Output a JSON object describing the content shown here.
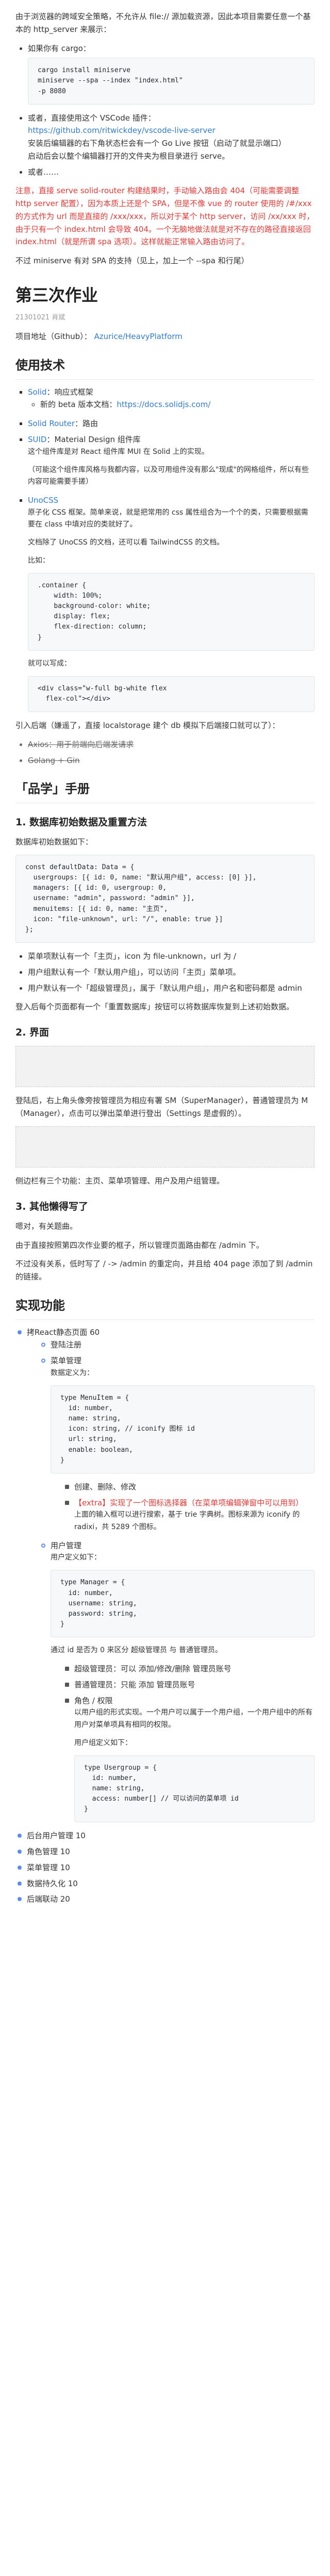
{
  "intro": {
    "p1": "由于浏览器的跨域安全策略，不允许从 file:// 源加载资源，因此本项目需要任意一个基本的 http_server 来展示：",
    "li_cargo": "如果你有 cargo：",
    "code_cargo": "cargo install miniserve\nminiserve --spa --index \"index.html\"\n-p 8080",
    "li_vscode": "或者，直接使用这个 VSCode 插件：",
    "vscode_link": "https://github.com/ritwickdey/vscode-live-server",
    "vscode_desc": "安装后编辑器的右下角状态栏会有一个 Go Live 按钮（启动了就显示端口）",
    "vscode_desc2": "启动后会以整个编辑器打开的文件夹为根目录进行 serve。",
    "li_or": "或者……",
    "warning": "注意，直接 serve solid-router 构建结果时，手动输入路由会 404（可能需要调整 http server 配置），因为本质上还是个 SPA，但是不像 vue 的 router 使用的 /#/xxx 的方式作为 url 而是直接的 /xxx/xxx，所以对于某个 http server，访问 /xx/xxx 时，由于只有一个 index.html 会导致 404。一个无脑地做法就是对不存在的路径直接返回 index.html（就是所谓 spa 选项）。这样就能正常输入路由访问了。",
    "miniserve": "不过 miniserve 有对 SPA 的支持（见上，加上一个 --spa 和行尾）"
  },
  "h1": {
    "title": "第三次作业",
    "meta": "21301021 肖斌",
    "project_label": "项目地址（Github）：",
    "project_link": "Azurice/HeavyPlatform"
  },
  "libs": {
    "title": "使用技术",
    "items": [
      {
        "name": "Solid",
        "desc": "：响应式框架"
      },
      {
        "name": "Solid Router",
        "desc": "：路由"
      },
      {
        "name": "SUID",
        "desc": "：Material Design 组件库"
      },
      {
        "name": "UnoCSS",
        "desc": ""
      }
    ],
    "solid_sub_label": "新的 beta 版本文档：",
    "solid_sub_link": "https://docs.solidjs.com/",
    "suid_desc": "这个组件库是对 React 组件库 MUI 在 Solid 上的实现。",
    "suid_desc2": "（可能这个组件库风格与我都内容，以及可用组件没有那么\"现成\"的网格组件，所以有些内容可能需要手搓）",
    "uno_desc": "原子化 CSS 框架。简单来说，就是把常用的 css 属性组合为一个个的类，只需要根据需要在 class 中填对应的类就好了。",
    "uno_desc2": "文档除了 UnoCSS 的文档，还可以看 TailwindCSS 的文档。",
    "uno_example_label": "比如：",
    "uno_code_css": ".container {\n    width: 100%;\n    background-color: white;\n    display: flex;\n    flex-direction: column;\n}",
    "uno_equal": "就可以写成：",
    "uno_code_html": "<div class=\"w-full bg-white flex\n  flex-col\"></div>"
  },
  "misc": {
    "quote": "引入后端（嫌遥了，直接 localstorage 建个 db 模拟下后端接口就可以了）：",
    "strike1": "Axios：用于前端向后端发请求",
    "strike2": "Golang + Gin"
  },
  "manual": {
    "title": "「品学」手册",
    "s1_title": "1. 数据库初始数据及重置方法",
    "s1_desc": "数据库初始数据如下：",
    "s1_code": "const defaultData: Data = {\n  usergroups: [{ id: 0, name: \"默认用户组\", access: [0] }],\n  managers: [{ id: 0, usergroup: 0,\n  username: \"admin\", password: \"admin\" }],\n  menuitems: [{ id: 0, name: \"主页\",\n  icon: \"file-unknown\", url: \"/\", enable: true }]\n};",
    "s1_li1": "菜单项默认有一个「主页」，icon 为 file-unknown，url 为 /",
    "s1_li2": "用户组默认有一个「默认用户组」，可以访问「主页」菜单项。",
    "s1_li3": "用户默认有一个「超级管理员」，属于「默认用户组」，用户名和密码都是 admin",
    "s1_reset": "登入后每个页面都有一个「重置数据库」按钮可以将数据库恢复到上述初始数据。",
    "s2_title": "2. 界面",
    "s2_desc": "登陆后，右上角头像旁按管理员为相应有署 SM（SuperManager），普通管理员为 M（Manager），点击可以弹出菜单进行登出（Settings 是虚假的）。",
    "s2_desc2": "侧边栏有三个功能：主页、菜单项管理、用户及用户组管理。",
    "s3_title": "3. 其他懒得写了",
    "s3_desc": "嗯对，有关题曲。",
    "s3_desc2": "由于直接按照第四次作业要的框子，所以管理页面路由都在 /admin 下。",
    "s3_desc3": "不过没有关系，低时写了 / -> /admin 的重定向，并且给 404 page 添加了到 /admin 的链接。"
  },
  "impl": {
    "title": "实现功能",
    "react_label": "拷React静态页面 60",
    "login": "登陆注册",
    "menu_mgr": "菜单管理",
    "data_def": "数据定义为：",
    "menu_code": "type MenuItem = {\n  id: number,\n  name: string,\n  icon: string, // iconify 图标 id\n  url: string,\n  enable: boolean,\n}",
    "crud": "创建、删除、修改",
    "extra": "【extra】实现了一个图标选择器（在菜单项编辑弹窗中可以用到）",
    "extra_desc": "上面的输入框可以进行搜索，基于 trie 字典树。图标来源为 iconify 的 radixi，共 5289 个图标。",
    "user_mgr": "用户管理",
    "user_def": "用户定义如下：",
    "user_code": "type Manager = {\n  id: number,\n  username: string,\n  password: string,\n}",
    "user_note": "通过 id 是否为 0 来区分 超级管理员 与 普通管理员。",
    "super_perm": "超级管理员：可以 添加/修改/删除 管理员账号",
    "normal_perm": "普通管理员：只能 添加 管理员账号",
    "role_perm": "角色 / 权限",
    "role_desc": "以用户组的形式实现。一个用户可以属于一个用户组，一个用户组中的所有用户对菜单项具有相同的权限。",
    "group_def": "用户组定义如下：",
    "group_code": "type Usergroup = {\n  id: number,\n  name: string,\n  access: number[] // 可以访问的菜单项 id\n}",
    "items": [
      "后台用户管理 10",
      "角色管理 10",
      "菜单管理 10",
      "数据持久化 10",
      "后端联动 20"
    ]
  }
}
